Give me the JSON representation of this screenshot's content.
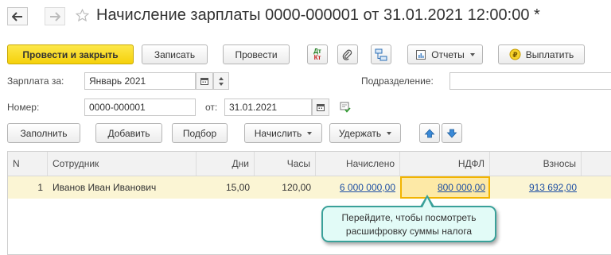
{
  "window": {
    "title": "Начисление зарплаты 0000-000001 от 31.01.2021 12:00:00 *",
    "star_icon": "star-icon"
  },
  "toolbar": {
    "post_close": "Провести и закрыть",
    "save": "Записать",
    "post": "Провести",
    "dtkt": {
      "dt": "Дт",
      "kt": "Кт"
    },
    "reports": "Отчеты",
    "pay": "Выплатить",
    "colors": {
      "primary": "#f5d10b",
      "pay_icon": "#e3b600"
    }
  },
  "form": {
    "salary_for_label": "Зарплата за:",
    "salary_for_value": "Январь 2021",
    "department_label": "Подразделение:",
    "department_value": "",
    "number_label": "Номер:",
    "number_value": "0000-000001",
    "from_label": "от:",
    "date_value": "31.01.2021"
  },
  "table_toolbar": {
    "fill": "Заполнить",
    "add": "Добавить",
    "select": "Подбор",
    "accrue": "Начислить",
    "withhold": "Удержать"
  },
  "table": {
    "headers": [
      "N",
      "Сотрудник",
      "Дни",
      "Часы",
      "Начислено",
      "НДФЛ",
      "Взносы"
    ],
    "rows": [
      {
        "n": "1",
        "employee": "Иванов Иван Иванович",
        "days": "15,00",
        "hours": "120,00",
        "accrued": "6 000 000,00",
        "ndfl": "800 000,00",
        "contributions": "913 692,00"
      }
    ],
    "highlight_color": "#f2b400"
  },
  "tooltip": {
    "line1": "Перейдите, чтобы посмотреть",
    "line2": "расшифровку суммы налога",
    "border_color": "#3aa19a",
    "background": "#e2fbf7"
  }
}
